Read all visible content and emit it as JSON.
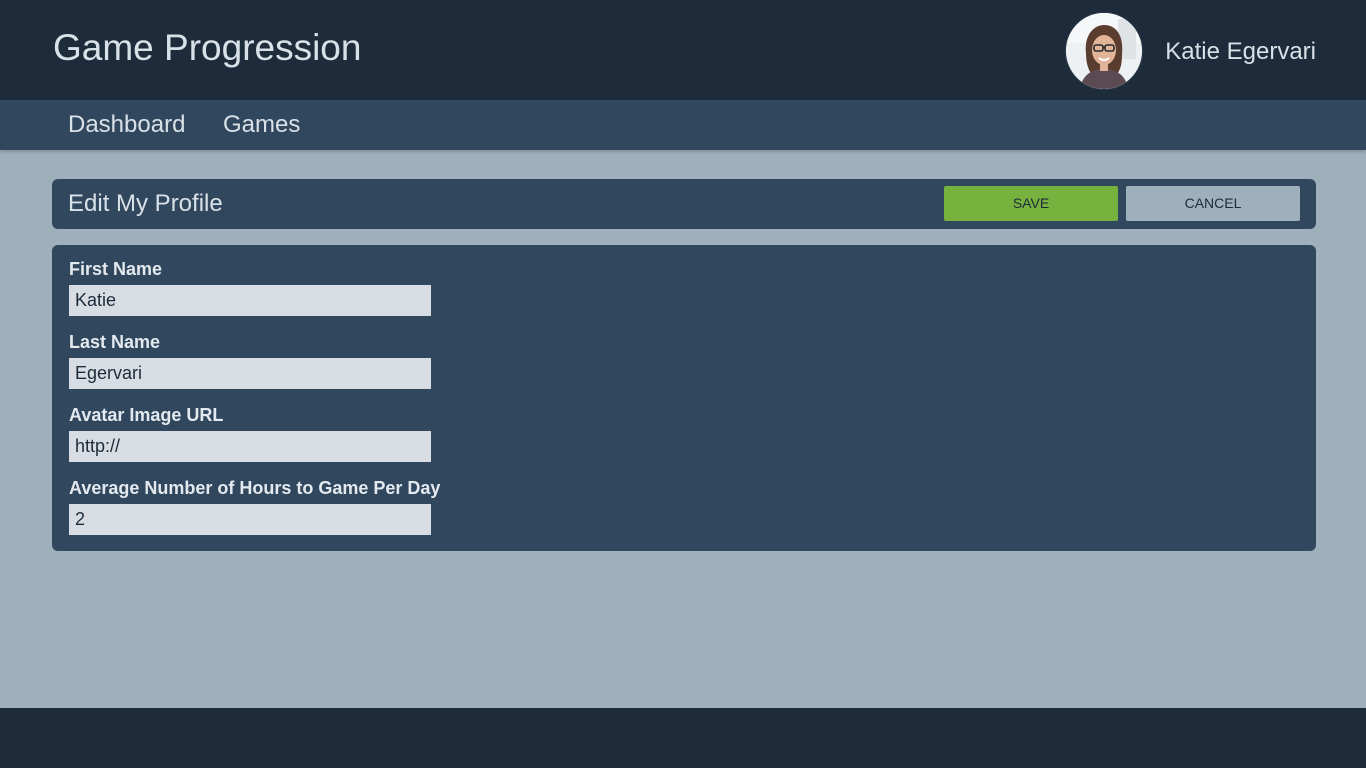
{
  "header": {
    "app_title": "Game Progression",
    "user_name": "Katie Egervari",
    "avatar_icon": "user-avatar-photo"
  },
  "nav": {
    "items": [
      {
        "label": "Dashboard"
      },
      {
        "label": "Games"
      }
    ]
  },
  "profile": {
    "title": "Edit My Profile",
    "save_label": "SAVE",
    "cancel_label": "CANCEL",
    "fields": [
      {
        "label": "First Name",
        "value": "Katie"
      },
      {
        "label": "Last Name",
        "value": "Egervari"
      },
      {
        "label": "Avatar Image URL",
        "value": "http://"
      },
      {
        "label": "Average Number of Hours to Game Per Day",
        "value": "2"
      }
    ]
  },
  "colors": {
    "header_bg": "#1e2b3a",
    "nav_bg": "#31475e",
    "page_bg": "#9fb0bd",
    "save_button": "#77b23f",
    "cancel_button": "#9fb0bd",
    "input_bg": "#d7dde2",
    "text_light": "#d9e1e8"
  }
}
